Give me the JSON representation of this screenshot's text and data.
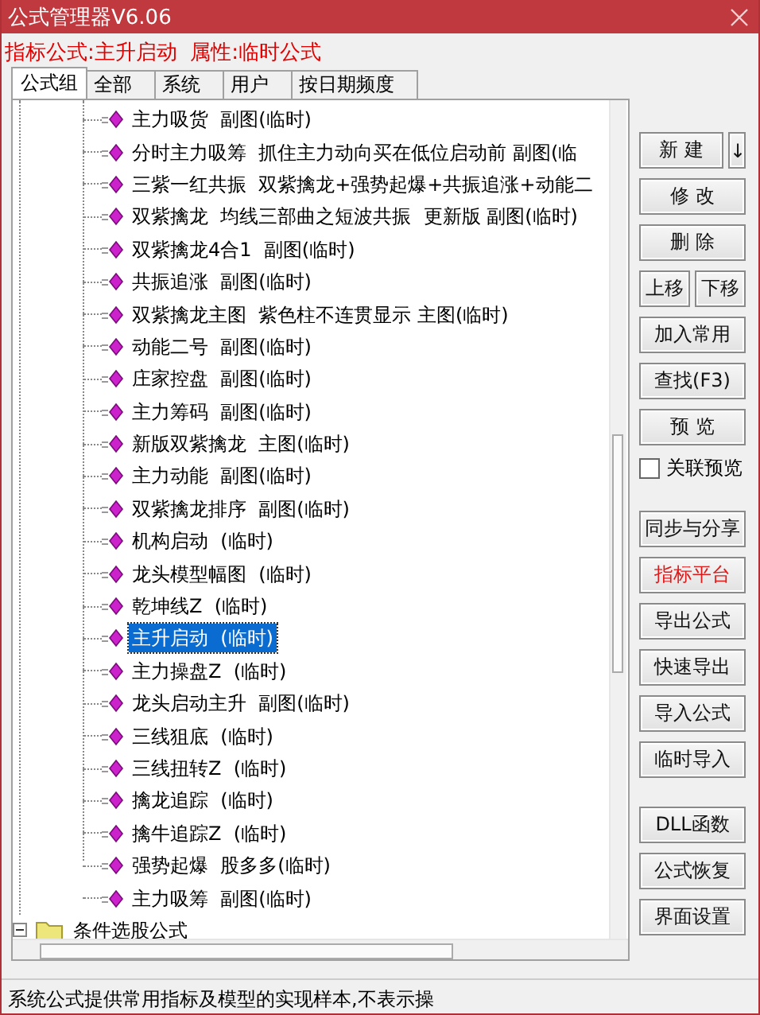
{
  "window": {
    "title": "公式管理器V6.06"
  },
  "info": "指标公式:主升启动  属性:临时公式",
  "tabs": [
    {
      "label": "公式组",
      "selected": true
    },
    {
      "label": "全部",
      "selected": false
    },
    {
      "label": "系统",
      "selected": false
    },
    {
      "label": "用户",
      "selected": false
    },
    {
      "label": "按日期频度",
      "selected": false
    }
  ],
  "tree": {
    "items": [
      {
        "label": "主力吸货  副图(临时)",
        "selected": false
      },
      {
        "label": "分时主力吸筹  抓住主力动向买在低位启动前 副图(临",
        "selected": false
      },
      {
        "label": "三紫一红共振  双紫擒龙+强势起爆+共振追涨+动能二",
        "selected": false
      },
      {
        "label": "双紫擒龙  均线三部曲之短波共振  更新版 副图(临时)",
        "selected": false
      },
      {
        "label": "双紫擒龙4合1  副图(临时)",
        "selected": false
      },
      {
        "label": "共振追涨  副图(临时)",
        "selected": false
      },
      {
        "label": "双紫擒龙主图  紫色柱不连贯显示 主图(临时)",
        "selected": false
      },
      {
        "label": "动能二号  副图(临时)",
        "selected": false
      },
      {
        "label": "庄家控盘  副图(临时)",
        "selected": false
      },
      {
        "label": "主力筹码  副图(临时)",
        "selected": false
      },
      {
        "label": "新版双紫擒龙  主图(临时)",
        "selected": false
      },
      {
        "label": "主力动能  副图(临时)",
        "selected": false
      },
      {
        "label": "双紫擒龙排序  副图(临时)",
        "selected": false
      },
      {
        "label": "机构启动  (临时)",
        "selected": false
      },
      {
        "label": "龙头模型幅图  (临时)",
        "selected": false
      },
      {
        "label": "乾坤线Z  (临时)",
        "selected": false
      },
      {
        "label": "主升启动  (临时)",
        "selected": true
      },
      {
        "label": "主力操盘Z  (临时)",
        "selected": false
      },
      {
        "label": "龙头启动主升  副图(临时)",
        "selected": false
      },
      {
        "label": "三线狙底  (临时)",
        "selected": false
      },
      {
        "label": "三线扭转Z  (临时)",
        "selected": false
      },
      {
        "label": "擒龙追踪  (临时)",
        "selected": false
      },
      {
        "label": "擒牛追踪Z  (临时)",
        "selected": false
      },
      {
        "label": "强势起爆  股多多(临时)",
        "selected": false
      },
      {
        "label": "主力吸筹  副图(临时)",
        "selected": false
      }
    ],
    "folder": {
      "label": "条件选股公式",
      "expanded": true
    }
  },
  "button_groups": [
    [
      {
        "label": "新 建",
        "kind": "split",
        "arrow": "↓",
        "accent": false
      },
      {
        "label": "修 改",
        "kind": "plain",
        "accent": false
      },
      {
        "label": "删 除",
        "kind": "plain",
        "accent": false
      },
      {
        "kind": "pair",
        "labels": [
          "上移",
          "下移"
        ],
        "accent": false
      },
      {
        "label": "加入常用",
        "kind": "plain",
        "accent": false
      },
      {
        "label": "查找(F3)",
        "kind": "plain",
        "accent": false
      },
      {
        "label": "预 览",
        "kind": "plain",
        "accent": false
      },
      {
        "label": "关联预览",
        "kind": "checkbox",
        "checked": false
      }
    ],
    [
      {
        "label": "同步与分享",
        "kind": "plain",
        "accent": false
      },
      {
        "label": "指标平台",
        "kind": "plain",
        "accent": true
      },
      {
        "label": "导出公式",
        "kind": "plain",
        "accent": false
      },
      {
        "label": "快速导出",
        "kind": "plain",
        "accent": false
      },
      {
        "label": "导入公式",
        "kind": "plain",
        "accent": false
      },
      {
        "label": "临时导入",
        "kind": "plain",
        "accent": false
      }
    ],
    [
      {
        "label": "DLL函数",
        "kind": "plain",
        "accent": false
      },
      {
        "label": "公式恢复",
        "kind": "plain",
        "accent": false
      },
      {
        "label": "界面设置",
        "kind": "plain",
        "accent": false
      }
    ]
  ],
  "status_bar": "系统公式提供常用指标及模型的实现样本,不表示操"
}
